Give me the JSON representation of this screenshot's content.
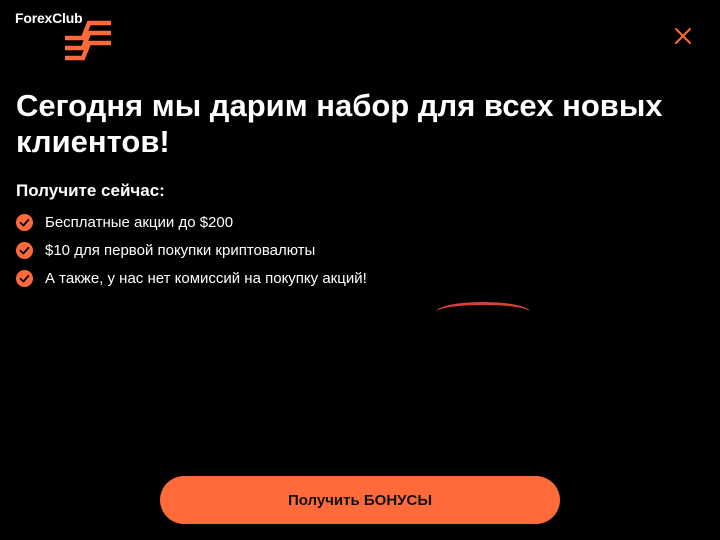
{
  "brand": {
    "logo_text": "ForexClub",
    "logo_icon": "forexclub-stripes-icon",
    "accent_color": "#ff6a3a"
  },
  "close_icon": "close-icon",
  "headline": "Сегодня мы дарим набор для всех новых клиентов!",
  "offer": {
    "title": "Получите сейчас:",
    "check_icon": "check-circle-icon",
    "items": [
      {
        "label": "Бесплатные акции до $200"
      },
      {
        "label": "$10 для первой покупки криптовалюты"
      },
      {
        "label": "А также, у нас нет комиссий на покупку акций!"
      }
    ]
  },
  "cta": {
    "label": "Получить БОНУСЫ"
  }
}
